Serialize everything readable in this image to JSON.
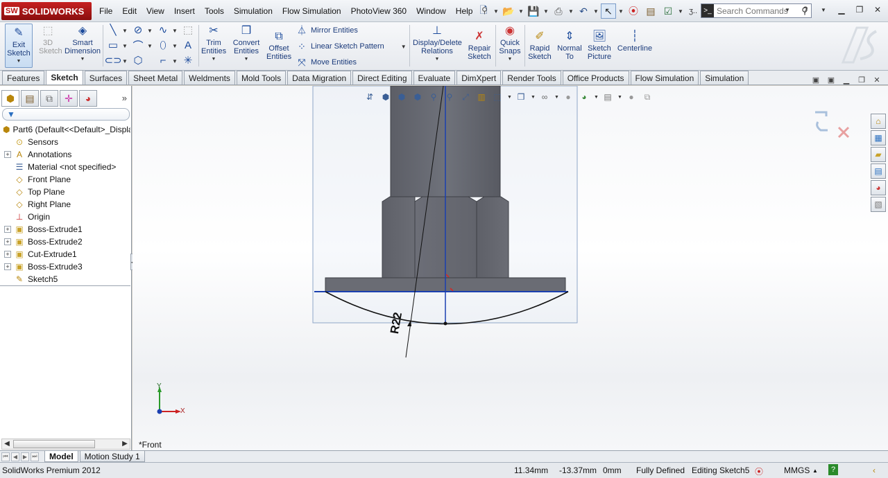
{
  "app": {
    "brand_mark": "SW",
    "brand": "SOLIDWORKS"
  },
  "menu": [
    "File",
    "Edit",
    "View",
    "Insert",
    "Tools",
    "Simulation",
    "Flow Simulation",
    "PhotoView 360",
    "Window",
    "Help"
  ],
  "search": {
    "placeholder": "Search Commands"
  },
  "ribbon": {
    "exit_sketch": "Exit Sketch",
    "sketch_3d": "3D Sketch",
    "smart_dimension": "Smart Dimension",
    "trim_entities": "Trim Entities",
    "convert_entities": "Convert Entities",
    "offset_entities": "Offset Entities",
    "mirror_entities": "Mirror Entities",
    "linear_sketch_pattern": "Linear Sketch Pattern",
    "move_entities": "Move Entities",
    "display_delete_relations": "Display/Delete Relations",
    "repair_sketch": "Repair Sketch",
    "quick_snaps": "Quick Snaps",
    "rapid_sketch": "Rapid Sketch",
    "normal_to": "Normal To",
    "sketch_picture": "Sketch Picture",
    "centerline": "Centerline"
  },
  "tabs": [
    "Features",
    "Sketch",
    "Surfaces",
    "Sheet Metal",
    "Weldments",
    "Mold Tools",
    "Data Migration",
    "Direct Editing",
    "Evaluate",
    "DimXpert",
    "Render Tools",
    "Office Products",
    "Flow Simulation",
    "Simulation"
  ],
  "active_tab": "Sketch",
  "tree": [
    {
      "label": "Part6  (Default<<Default>_Displa",
      "icon": "part-icon",
      "expandable": false,
      "root": true
    },
    {
      "label": "Sensors",
      "icon": "sensor-icon",
      "expandable": false
    },
    {
      "label": "Annotations",
      "icon": "annotation-icon",
      "expandable": true
    },
    {
      "label": "Material <not specified>",
      "icon": "material-icon",
      "expandable": false
    },
    {
      "label": "Front Plane",
      "icon": "plane-icon",
      "expandable": false
    },
    {
      "label": "Top Plane",
      "icon": "plane-icon",
      "expandable": false
    },
    {
      "label": "Right Plane",
      "icon": "plane-icon",
      "expandable": false
    },
    {
      "label": "Origin",
      "icon": "origin-icon",
      "expandable": false
    },
    {
      "label": "Boss-Extrude1",
      "icon": "extrude-icon",
      "expandable": true
    },
    {
      "label": "Boss-Extrude2",
      "icon": "extrude-icon",
      "expandable": true
    },
    {
      "label": "Cut-Extrude1",
      "icon": "cut-icon",
      "expandable": true
    },
    {
      "label": "Boss-Extrude3",
      "icon": "extrude-icon",
      "expandable": true
    },
    {
      "label": "Sketch5",
      "icon": "sketch-icon",
      "expandable": false
    }
  ],
  "viewport": {
    "view_name": "*Front",
    "dimension": "R22",
    "axis_x": "X",
    "axis_y": "Y"
  },
  "bottom_tabs": [
    "Model",
    "Motion Study 1"
  ],
  "status": {
    "product": "SolidWorks Premium 2012",
    "x": "11.34mm",
    "y": "-13.37mm",
    "z": "0mm",
    "state": "Fully Defined",
    "editing": "Editing Sketch5",
    "units": "MMGS"
  },
  "colors": {
    "accent": "#1b4a9b",
    "sketch_line": "#1a3fb0",
    "brand_red": "#b01414"
  }
}
